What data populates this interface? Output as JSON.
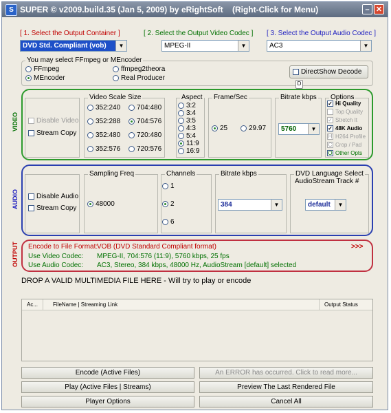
{
  "window": {
    "title": "SUPER © v2009.build.35 (Jan 5, 2009) by eRightSoft",
    "menu_hint": "(Right-Click for Menu)",
    "minimize": "–",
    "close": "✕"
  },
  "steps": {
    "container_label": "[ 1.     Select the Output Container ]",
    "video_codec_label": "[ 2.  Select the Output Video Codec ]",
    "audio_codec_label": "[ 3.  Select the Output Audio Codec ]",
    "container_value": "DVD  Std. Compliant (vob)",
    "video_codec_value": "MPEG-II",
    "audio_codec_value": "AC3"
  },
  "encoder": {
    "caption": "You may select FFmpeg or MEncoder",
    "options": [
      "FFmpeg",
      "MEncoder",
      "ffmpeg2theora",
      "Real Producer"
    ],
    "selected": "MEncoder",
    "directshow": "DirectShow Decode",
    "directshow_key": "D"
  },
  "video": {
    "side_label": "VIDEO",
    "disable": "Disable Video",
    "stream_copy": "Stream Copy",
    "scale_title": "Video Scale Size",
    "scale_sizes": [
      "352:240",
      "704:480",
      "352:288",
      "704:576",
      "352:480",
      "720:480",
      "352:576",
      "720:576"
    ],
    "scale_selected": "704:576",
    "aspect_title": "Aspect",
    "aspects": [
      "3:2",
      "3:4",
      "3:5",
      "4:3",
      "5:4",
      "11:9",
      "16:9"
    ],
    "aspect_selected": "11:9",
    "fps_title": "Frame/Sec",
    "fps": [
      "25",
      "29.97"
    ],
    "fps_selected": "25",
    "bitrate_title": "Bitrate  kbps",
    "bitrate_value": "5760",
    "options_title": "Options",
    "options": [
      {
        "label": "Hi Quality",
        "key": "✓",
        "state": "checked"
      },
      {
        "label": "Top Quality",
        "key": "",
        "state": "disabled"
      },
      {
        "label": "Stretch It",
        "key": "✓",
        "state": "disabled"
      },
      {
        "label": "48K Audio",
        "key": "✓",
        "state": "checked"
      },
      {
        "label": "H264 Profile",
        "key": "H",
        "state": "disabled"
      },
      {
        "label": "Crop / Pad",
        "key": "C",
        "state": "disabled"
      },
      {
        "label": "Other Opts",
        "key": "O",
        "state": "enabled"
      }
    ]
  },
  "audio": {
    "side_label": "AUDIO",
    "disable": "Disable Audio",
    "stream_copy": "Stream Copy",
    "sampling_title": "Sampling Freq",
    "sampling_value": "48000",
    "channels_title": "Channels",
    "channels": [
      "1",
      "2",
      "6"
    ],
    "channels_selected": "2",
    "bitrate_title": "Bitrate  kbps",
    "bitrate_value": "384",
    "language_title": "DVD Language Select",
    "language_subtitle": "AudioStream  Track #",
    "language_value": "default"
  },
  "output": {
    "side_label": "OUTPUT",
    "rows": [
      {
        "label": "Encode to File Format:",
        "value": "VOB (DVD Standard Compliant format)"
      },
      {
        "label": "Use Video Codec:",
        "value": "MPEG-II,  704:576 (11:9),  5760 kbps,  25 fps"
      },
      {
        "label": "Use Audio Codec:",
        "value": "AC3,  Stereo,  384 kbps,  48000 Hz,  AudioStream [default] selected"
      }
    ],
    "more": ">>>"
  },
  "drop_message": "DROP A VALID MULTIMEDIA FILE HERE - Will try to play or encode",
  "file_table": {
    "columns": [
      "Ac...",
      "FileName  |  Streaming Link",
      "Output Status"
    ]
  },
  "buttons": {
    "encode": "Encode (Active Files)",
    "error": "An ERROR has occurred. Click to read more...",
    "play": "Play (Active Files | Streams)",
    "preview": "Preview The Last Rendered File",
    "player_options": "Player Options",
    "cancel_all": "Cancel All"
  },
  "colors": {
    "video_panel": "#2c9a2c",
    "audio_panel": "#2a3fb0",
    "output_panel": "#c03040",
    "selected_combo": "#1e50c8"
  }
}
